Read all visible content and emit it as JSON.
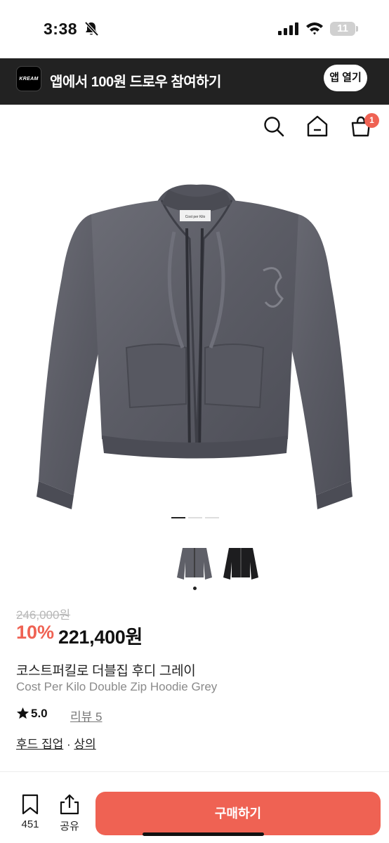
{
  "status_bar": {
    "time": "3:38",
    "battery": "11"
  },
  "app_banner": {
    "logo_text": "KREAM",
    "text": "앱에서 100원 드로우 참여하기",
    "open_button": "앱 열기"
  },
  "header": {
    "cart_count": "1"
  },
  "product": {
    "original_price": "246,000원",
    "discount_rate": "10%",
    "price": "221,400원",
    "title_ko": "코스트퍼킬로 더블집 후디 그레이",
    "title_en": "Cost Per Kilo Double Zip Hoodie Grey",
    "rating": "5.0",
    "review_text": "리뷰 5",
    "category_1": "후드 집업",
    "separator": " · ",
    "category_2": "상의",
    "label_text": "Cost per Kilo"
  },
  "carousel": {
    "image_count": 3,
    "active_index": 0
  },
  "bottom_bar": {
    "bookmark_count": "451",
    "share_label": "공유",
    "buy_button": "구매하기"
  },
  "colors": {
    "accent": "#ef6253",
    "banner_bg": "#222222",
    "hoodie_grey": "#5f6068"
  },
  "icons": [
    "bell-slash-icon",
    "signal-icon",
    "wifi-icon",
    "search-icon",
    "home-icon",
    "cart-icon",
    "star-icon",
    "bookmark-icon",
    "share-icon"
  ]
}
